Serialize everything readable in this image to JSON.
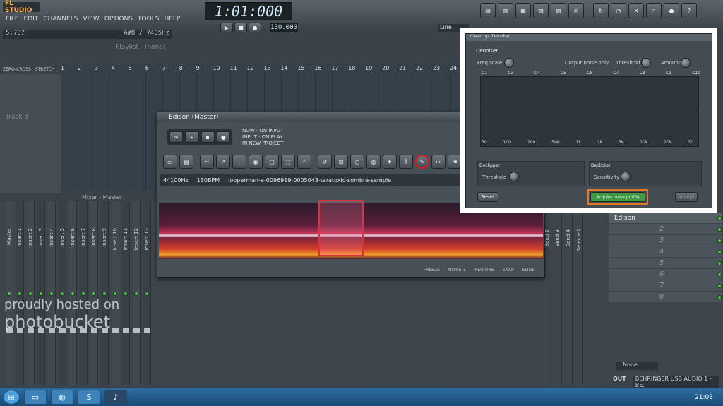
{
  "app": {
    "logo": "FL STUDIO"
  },
  "menu": [
    "FILE",
    "EDIT",
    "CHANNELS",
    "VIEW",
    "OPTIONS",
    "TOOLS",
    "HELP"
  ],
  "hint_bar": {
    "left": "5:737",
    "right": "A#8 / 7405Hz"
  },
  "transport": {
    "time": "1:01:000",
    "tempo": "130.000",
    "pattern_label": "Line"
  },
  "playlist": {
    "title": "Playlist - (none)",
    "ruler": [
      "1",
      "2",
      "3",
      "4",
      "5",
      "6",
      "7",
      "8",
      "9",
      "10",
      "11",
      "12",
      "13",
      "14",
      "15",
      "16",
      "17",
      "18",
      "19",
      "20",
      "21",
      "22",
      "23",
      "24"
    ],
    "zero_cross": "ZERO-CROSS",
    "stretch": "STRETCH",
    "track": "Track 3"
  },
  "edison": {
    "title": "Edison (Master)",
    "record_options": [
      "NOW",
      "INPUT",
      "ON INPUT",
      "ON PLAY",
      "IN NEW PROJECT"
    ],
    "sample_rate": "44100Hz",
    "tempo": "130BPM",
    "sample_name": "looperman-a-0096919-0005043-taratoxic-sombre-sample",
    "bottom_labels": [
      "FREEZE",
      "NOISE T.",
      "REGIONS",
      "SNAP",
      "SLIDE"
    ],
    "selection_color": "#e0303a",
    "highlight_color": "#e8141c"
  },
  "mixer": {
    "title": "Mixer - Master",
    "strips": [
      "Master",
      "Insert 1",
      "Insert 2",
      "Insert 3",
      "Insert 4",
      "Insert 5",
      "Insert 6",
      "Insert 7",
      "Insert 8",
      "Insert 9",
      "Insert 10",
      "Insert 11",
      "Insert 12",
      "Insert 13"
    ],
    "sends": [
      "Send 2",
      "Send 3",
      "Send 4",
      "Selected"
    ],
    "output": "OUT",
    "output_device": "BEHRINGER USB AUDIO 1 - BE.",
    "slot_none": "None"
  },
  "channels": {
    "list_title": "Edison",
    "slots": [
      "2",
      "3",
      "4",
      "5",
      "6",
      "7",
      "8"
    ]
  },
  "cleanup": {
    "title": "Clean up (Denoise)",
    "section": "Denoiser",
    "freq_scale": "Freq scale",
    "output_noise_only": "Output noise only",
    "threshold": "Threshold",
    "amount": "Amount",
    "notes": [
      "C1",
      "C3",
      "C4",
      "C5",
      "C6",
      "C7",
      "C8",
      "C9",
      "C10"
    ],
    "freqs": [
      "30",
      "100",
      "200",
      "500",
      "1k",
      "2k",
      "5k",
      "10k",
      "20k",
      "30"
    ],
    "declipper": "Declipper",
    "declipper_threshold": "Threshold",
    "declicker": "Declicker",
    "sensitivity": "Sensitivity",
    "reset": "Reset",
    "acquire": "Acquire noise profile",
    "accept": "Accept",
    "accent_color": "#e07a2a",
    "acquire_color": "#3e9a44"
  },
  "watermark": {
    "line1": "proudly hosted on",
    "line2": "photobucket"
  },
  "taskbar": {
    "clock": "21:03"
  }
}
